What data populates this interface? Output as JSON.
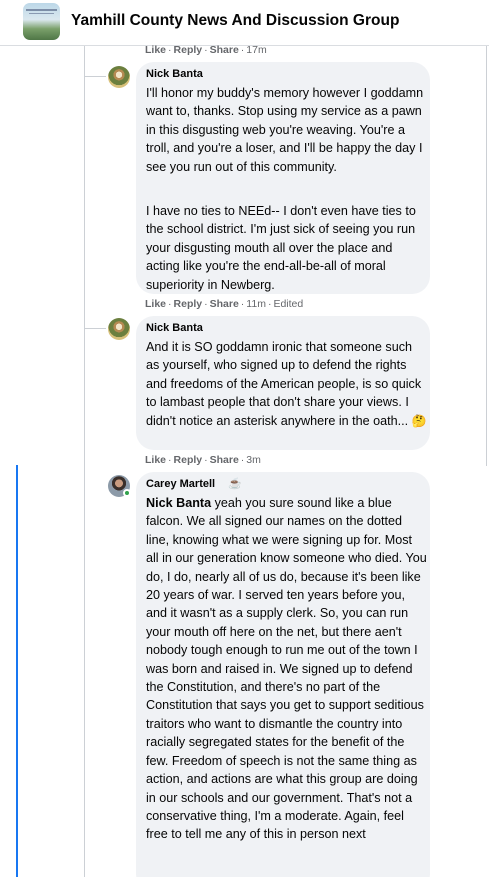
{
  "header": {
    "group_title": "Yamhill County News And Discussion Group",
    "thumbnail_icon": "group-cover-icon"
  },
  "top_actions": {
    "like": "Like",
    "reply": "Reply",
    "share": "Share",
    "time": "17m"
  },
  "comments": [
    {
      "author": "Nick Banta",
      "paragraphs": [
        "I'll honor my buddy's memory however I goddamn want to, thanks. Stop using my service as a pawn in this disgusting web you're weaving. You're a troll, and you're a loser, and I'll be happy the day I see you run out of this community.",
        "I have no ties to NEEd-- I don't even have ties to the school district. I'm just sick of seeing you run your disgusting mouth all over the place and acting like you're the end-all-be-all of moral superiority in Newberg."
      ],
      "actions": {
        "like": "Like",
        "reply": "Reply",
        "share": "Share",
        "time": "11m",
        "edited": "Edited"
      }
    },
    {
      "author": "Nick Banta",
      "paragraphs": [
        "And it is SO goddamn ironic that someone such as yourself, who signed up to defend the rights and freedoms of the American people, is so quick to lambast people that don't share your views. I didn't notice an asterisk anywhere in the oath..."
      ],
      "emoji": "🤔",
      "actions": {
        "like": "Like",
        "reply": "Reply",
        "share": "Share",
        "time": "3m"
      }
    },
    {
      "author": "Carey Martell",
      "badge_icon": "coffee-cup-icon",
      "mention": "Nick Banta",
      "text": "yeah you sure sound like a blue falcon. We all signed our names on the dotted line, knowing what we were signing up for. Most all in our generation know someone who died. You do, I do, nearly all of us do, because it's been like 20 years of war. I served ten years before you, and it wasn't as a supply clerk. So, you can run your mouth off here on the net, but there aen't nobody tough enough to run me out of the town I was born and raised in. We signed up to defend the Constitution, and there's no part of the Constitution that says you get to support seditious traitors who want to dismantle the country into racially segregated states for the benefit of the few. Freedom of speech is not the same thing as action, and actions are what this group are doing in our schools and our government. That's not a conservative thing, I'm a moderate. Again, feel free to tell me any of this in person next"
    }
  ],
  "colors": {
    "accent": "#1877f2",
    "bubble": "#f0f2f5",
    "meta": "#65676b",
    "online": "#31a24c"
  }
}
